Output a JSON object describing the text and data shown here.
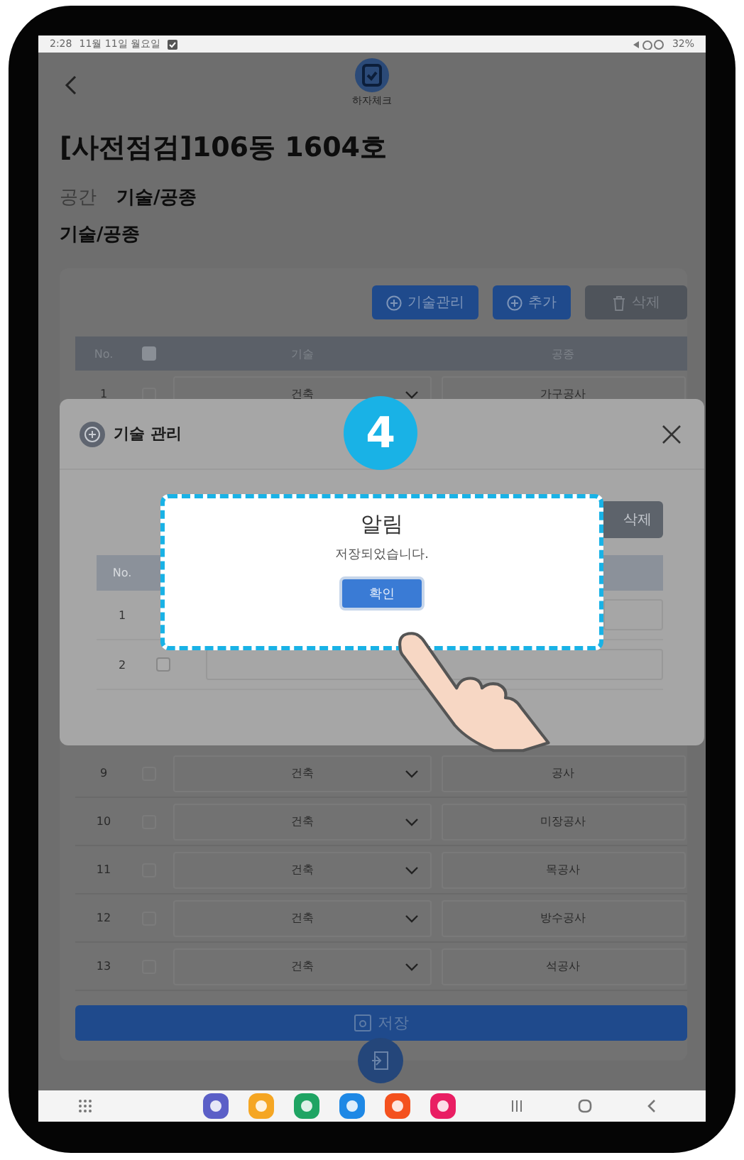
{
  "status_bar": {
    "time": "2:28",
    "date": "11월 11일 월요일",
    "battery": "32%"
  },
  "app_header": {
    "logo_label": "하자체크"
  },
  "page_title": "[사전점검]106동 1604호",
  "breadcrumb": {
    "label": "공간",
    "value": "기술/공종"
  },
  "section_title": "기술/공종",
  "toolbar_buttons": [
    {
      "kind": "add",
      "label": "기술관리"
    },
    {
      "kind": "add",
      "label": "추가"
    },
    {
      "kind": "delete",
      "label": "삭제"
    }
  ],
  "table": {
    "columns": [
      "No.",
      "기술",
      "공종"
    ],
    "all_checked": false,
    "rows": [
      {
        "no": "1",
        "trade": "건축",
        "work": "가구공사",
        "checked": false
      },
      {
        "no": "9",
        "trade": "건축",
        "work": "공사",
        "checked": false
      },
      {
        "no": "10",
        "trade": "건축",
        "work": "미장공사",
        "checked": false
      },
      {
        "no": "11",
        "trade": "건축",
        "work": "목공사",
        "checked": false
      },
      {
        "no": "12",
        "trade": "건축",
        "work": "방수공사",
        "checked": false
      },
      {
        "no": "13",
        "trade": "건축",
        "work": "석공사",
        "checked": false
      }
    ]
  },
  "save_button": "저장",
  "modal": {
    "title": "기술 관리",
    "delete_button": "삭제",
    "column": "No.",
    "rows": [
      {
        "no": "1"
      },
      {
        "no": "2",
        "checked": false
      }
    ]
  },
  "alert": {
    "title": "알림",
    "message": "저장되었습니다.",
    "confirm_button": "확인"
  },
  "step_badge": "4"
}
